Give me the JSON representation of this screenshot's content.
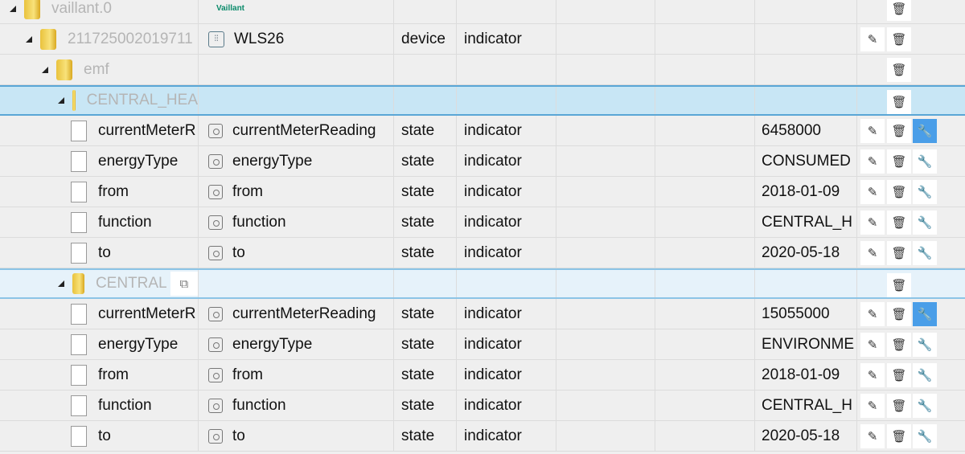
{
  "rows": [
    {
      "level": 0,
      "kind": "folder",
      "id": "vaillant.0",
      "name": "",
      "logo": "Vaillant",
      "type": "",
      "role": "",
      "value": "",
      "buttons": [
        "delete"
      ]
    },
    {
      "level": 1,
      "kind": "folder",
      "id": "211725002019711",
      "name": "WLS26",
      "name_icon": "device-icon",
      "type": "device",
      "role": "indicator",
      "value": "",
      "buttons": [
        "edit",
        "delete"
      ]
    },
    {
      "level": 2,
      "kind": "folder",
      "id": "emf",
      "name": "",
      "type": "",
      "role": "",
      "value": "",
      "buttons": [
        "delete"
      ]
    },
    {
      "level": 3,
      "kind": "folder",
      "id": "CENTRAL_HEA",
      "name": "",
      "type": "",
      "role": "",
      "value": "",
      "buttons": [
        "delete"
      ],
      "selected": true
    },
    {
      "kind": "state",
      "id": "currentMeterR",
      "name": "currentMeterReading",
      "type": "state",
      "role": "indicator",
      "value": "6458000",
      "buttons": [
        "edit",
        "delete",
        "settings"
      ],
      "active_settings": true
    },
    {
      "kind": "state",
      "id": "energyType",
      "name": "energyType",
      "type": "state",
      "role": "indicator",
      "value": "CONSUMED",
      "buttons": [
        "edit",
        "delete",
        "settings"
      ]
    },
    {
      "kind": "state",
      "id": "from",
      "name": "from",
      "type": "state",
      "role": "indicator",
      "value": "2018-01-09",
      "buttons": [
        "edit",
        "delete",
        "settings"
      ]
    },
    {
      "kind": "state",
      "id": "function",
      "name": "function",
      "type": "state",
      "role": "indicator",
      "value": "CENTRAL_H",
      "buttons": [
        "edit",
        "delete",
        "settings"
      ]
    },
    {
      "kind": "state",
      "id": "to",
      "name": "to",
      "type": "state",
      "role": "indicator",
      "value": "2020-05-18",
      "buttons": [
        "edit",
        "delete",
        "settings"
      ]
    },
    {
      "level": 3,
      "kind": "folder",
      "id": "CENTRAL",
      "name": "",
      "type": "",
      "role": "",
      "value": "",
      "buttons": [
        "delete"
      ],
      "hover": true,
      "copy": true
    },
    {
      "kind": "state",
      "id": "currentMeterR",
      "name": "currentMeterReading",
      "type": "state",
      "role": "indicator",
      "value": "15055000",
      "buttons": [
        "edit",
        "delete",
        "settings"
      ],
      "active_settings": true
    },
    {
      "kind": "state",
      "id": "energyType",
      "name": "energyType",
      "type": "state",
      "role": "indicator",
      "value": "ENVIRONME",
      "buttons": [
        "edit",
        "delete",
        "settings"
      ]
    },
    {
      "kind": "state",
      "id": "from",
      "name": "from",
      "type": "state",
      "role": "indicator",
      "value": "2018-01-09",
      "buttons": [
        "edit",
        "delete",
        "settings"
      ]
    },
    {
      "kind": "state",
      "id": "function",
      "name": "function",
      "type": "state",
      "role": "indicator",
      "value": "CENTRAL_H",
      "buttons": [
        "edit",
        "delete",
        "settings"
      ]
    },
    {
      "kind": "state",
      "id": "to",
      "name": "to",
      "type": "state",
      "role": "indicator",
      "value": "2020-05-18",
      "buttons": [
        "edit",
        "delete",
        "settings"
      ]
    }
  ],
  "colors": {
    "selected": "#c8e6f5",
    "accent": "#4a9ee8"
  }
}
